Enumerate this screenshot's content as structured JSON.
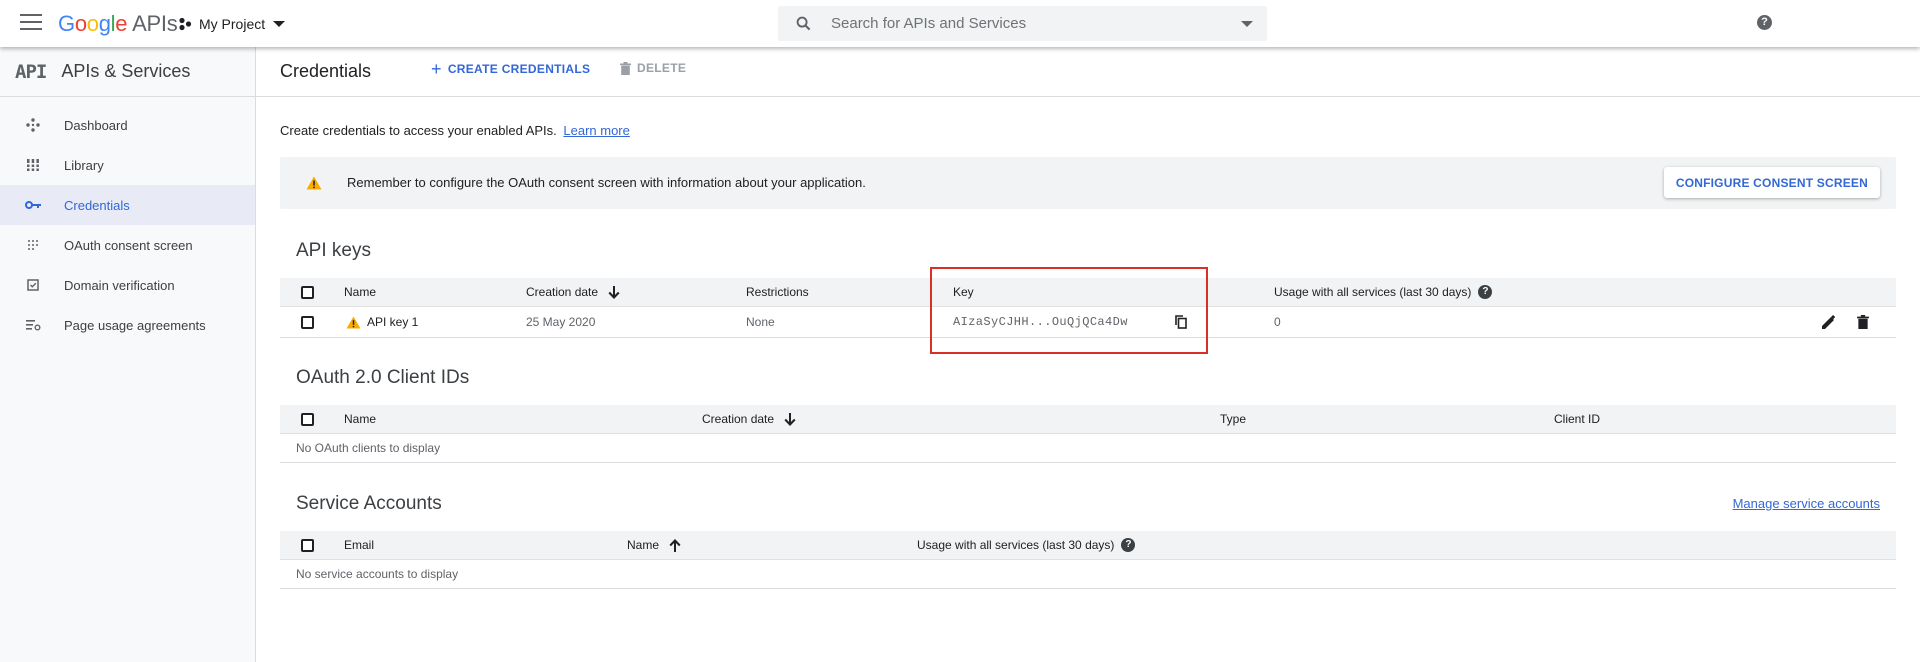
{
  "topbar": {
    "logo_google": [
      "G",
      "o",
      "o",
      "g",
      "l",
      "e"
    ],
    "logo_suffix": "APIs",
    "project_name": "My Project",
    "search_placeholder": "Search for APIs and Services",
    "help_glyph": "?"
  },
  "sidebar": {
    "api_mark": "API",
    "title": "APIs & Services",
    "items": [
      {
        "label": "Dashboard",
        "icon": "dashboard-icon",
        "active": false
      },
      {
        "label": "Library",
        "icon": "library-icon",
        "active": false
      },
      {
        "label": "Credentials",
        "icon": "key-icon",
        "active": true
      },
      {
        "label": "OAuth consent screen",
        "icon": "consent-icon",
        "active": false
      },
      {
        "label": "Domain verification",
        "icon": "domain-icon",
        "active": false
      },
      {
        "label": "Page usage agreements",
        "icon": "settings-list-icon",
        "active": false
      }
    ]
  },
  "header": {
    "title": "Credentials",
    "create_label": "CREATE CREDENTIALS",
    "create_glyph": "+",
    "delete_label": "DELETE"
  },
  "intro": {
    "text": "Create credentials to access your enabled APIs.",
    "link": "Learn more"
  },
  "banner": {
    "text": "Remember to configure the OAuth consent screen with information about your application.",
    "button": "CONFIGURE CONSENT SCREEN"
  },
  "api_keys": {
    "title": "API keys",
    "columns": {
      "name": "Name",
      "creation_date": "Creation date",
      "restrictions": "Restrictions",
      "key": "Key",
      "usage": "Usage with all services (last 30 days)"
    },
    "rows": [
      {
        "name": "API key 1",
        "creation_date": "25 May 2020",
        "restrictions": "None",
        "key": "AIzaSyCJHH...OuQjQCa4Dw",
        "usage": "0"
      }
    ]
  },
  "oauth_clients": {
    "title": "OAuth 2.0 Client IDs",
    "columns": {
      "name": "Name",
      "creation_date": "Creation date",
      "type": "Type",
      "client_id": "Client ID"
    },
    "empty": "No OAuth clients to display"
  },
  "service_accounts": {
    "title": "Service Accounts",
    "manage_link": "Manage service accounts",
    "columns": {
      "email": "Email",
      "name": "Name",
      "usage": "Usage with all services (last 30 days)"
    },
    "empty": "No service accounts to display"
  },
  "colors": {
    "accent": "#3367d6",
    "warning": "#f9ab00",
    "highlight_box": "#d93025"
  }
}
